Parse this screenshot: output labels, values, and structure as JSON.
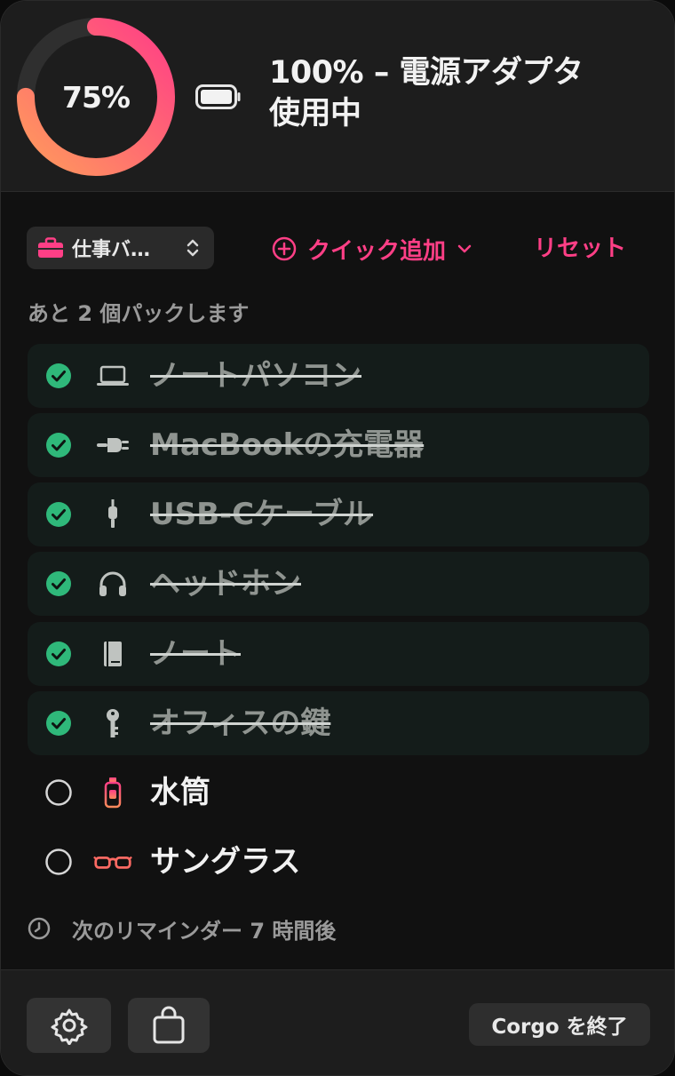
{
  "header": {
    "ring_percent": 75,
    "ring_label": "75%",
    "power_line1": "100% – 電源アダプタ",
    "power_line2": "使用中",
    "accent_gradient": [
      "#ff9a5c",
      "#ff3f86"
    ]
  },
  "toolbar": {
    "bag_label": "仕事バ…",
    "quick_add_label": "クイック追加",
    "reset_label": "リセット"
  },
  "status": {
    "remaining_text": "あと 2 個パックします"
  },
  "items": [
    {
      "label": "ノートパソコン",
      "done": true,
      "icon": "laptop-icon"
    },
    {
      "label": "MacBookの充電器",
      "done": true,
      "icon": "plug-icon"
    },
    {
      "label": "USB-Cケーブル",
      "done": true,
      "icon": "cable-icon"
    },
    {
      "label": "ヘッドホン",
      "done": true,
      "icon": "headphones-icon"
    },
    {
      "label": "ノート",
      "done": true,
      "icon": "notebook-icon"
    },
    {
      "label": "オフィスの鍵",
      "done": true,
      "icon": "key-icon"
    },
    {
      "label": "水筒",
      "done": false,
      "icon": "water-bottle-icon"
    },
    {
      "label": "サングラス",
      "done": false,
      "icon": "sunglasses-icon"
    }
  ],
  "reminder": {
    "text": "次のリマインダー 7 時間後"
  },
  "footer": {
    "quit_label": "Corgo を終了"
  },
  "colors": {
    "accent": "#ff3f86",
    "check_green": "#2fb87a"
  }
}
